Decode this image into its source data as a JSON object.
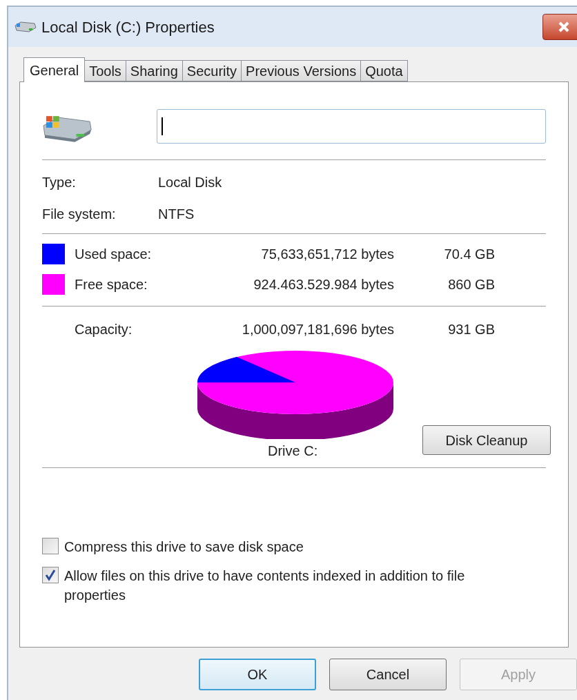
{
  "window": {
    "title": "Local Disk (C:) Properties"
  },
  "tabs": [
    {
      "label": "General",
      "selected": true
    },
    {
      "label": "Tools",
      "selected": false
    },
    {
      "label": "Sharing",
      "selected": false
    },
    {
      "label": "Security",
      "selected": false
    },
    {
      "label": "Previous Versions",
      "selected": false
    },
    {
      "label": "Quota",
      "selected": false
    }
  ],
  "info": [
    {
      "label": "Type:",
      "value": "Local Disk"
    },
    {
      "label": "File system:",
      "value": "NTFS"
    }
  ],
  "space": [
    {
      "label": "Used space:",
      "bytes": "75,633,651,712 bytes",
      "size": "70.4 GB",
      "color": "#0000ff"
    },
    {
      "label": "Free space:",
      "bytes": "924.463.529.984 bytes",
      "size": "860 GB",
      "color": "#ff00ff"
    }
  ],
  "capacity": {
    "label": "Capacity:",
    "bytes": "1,000,097,181,696 bytes",
    "size": "931 GB"
  },
  "drive_label": "Drive C:",
  "cleanup_button": "Disk Cleanup",
  "options": [
    {
      "label": "Compress this drive to save disk space",
      "checked": false
    },
    {
      "label": "Allow files on this drive to have contents indexed in addition to file properties",
      "checked": true
    }
  ],
  "buttons": [
    {
      "label": "OK",
      "kind": "default",
      "disabled": false
    },
    {
      "label": "Cancel",
      "kind": "normal",
      "disabled": false
    },
    {
      "label": "Apply",
      "kind": "normal",
      "disabled": true
    }
  ]
}
